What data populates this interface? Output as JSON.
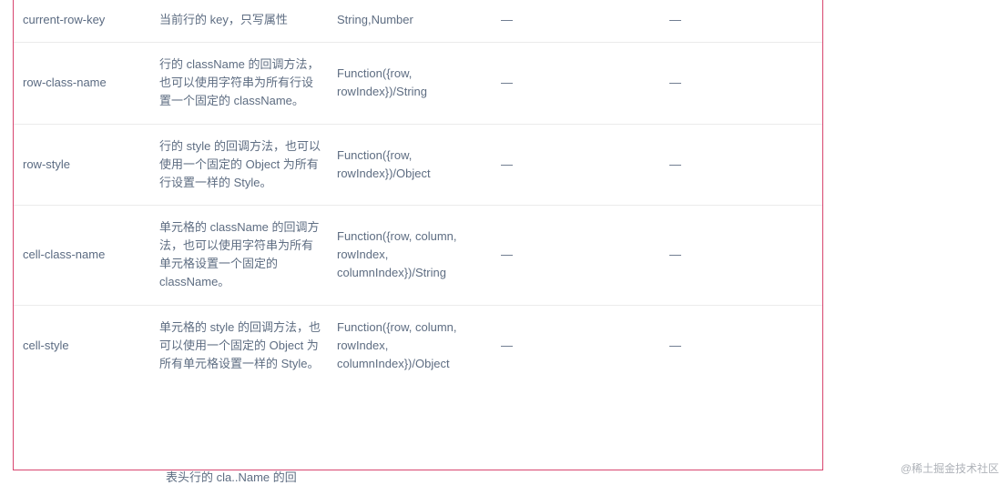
{
  "rows": [
    {
      "name": "current-row-key",
      "desc": "当前行的 key，只写属性",
      "type": "String,Number",
      "opts": "—",
      "def": "—"
    },
    {
      "name": "row-class-name",
      "desc": "行的 className 的回调方法，也可以使用字符串为所有行设置一个固定的 className。",
      "type": "Function({row, rowIndex})/String",
      "opts": "—",
      "def": "—"
    },
    {
      "name": "row-style",
      "desc": "行的 style 的回调方法，也可以使用一个固定的 Object 为所有行设置一样的 Style。",
      "type": "Function({row, rowIndex})/Object",
      "opts": "—",
      "def": "—"
    },
    {
      "name": "cell-class-name",
      "desc": "单元格的 className 的回调方法，也可以使用字符串为所有单元格设置一个固定的 className。",
      "type": "Function({row, column, rowIndex, columnIndex})/String",
      "opts": "—",
      "def": "—"
    },
    {
      "name": "cell-style",
      "desc": "单元格的 style 的回调方法，也可以使用一个固定的 Object 为所有单元格设置一样的 Style。",
      "type": "Function({row, column, rowIndex, columnIndex})/Object",
      "opts": "—",
      "def": "—"
    }
  ],
  "watermark": "@稀土掘金技术社区",
  "cutoff": "表头行的 cla..Name  的回"
}
